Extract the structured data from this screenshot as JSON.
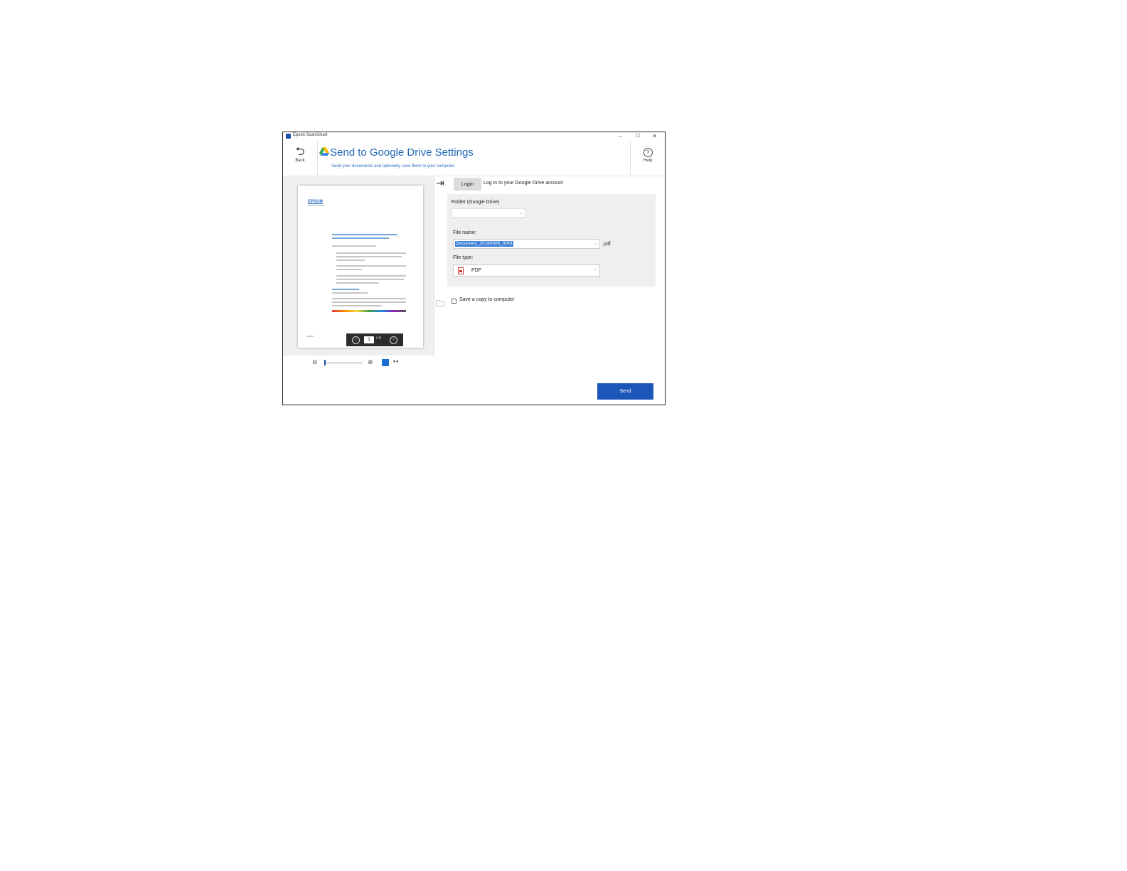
{
  "window": {
    "app_title": "Epson ScanSmart",
    "controls": {
      "minimize": "–",
      "maximize": "☐",
      "close": "✕"
    }
  },
  "header": {
    "back_label": "Back",
    "title": "Send to Google Drive Settings",
    "subtitle": "Send your documents and optionally save them to your computer.",
    "help_label": "Help"
  },
  "preview": {
    "doc_logo": "EPSON",
    "pager": {
      "current": "1",
      "of": "/ 4"
    }
  },
  "login": {
    "button_label": "Login",
    "text": "Log in to your Google Drive account"
  },
  "settings": {
    "folder_label": "Folder (Google Drive)",
    "folder_value": "",
    "file_name_label": "File name:",
    "file_name_value": "Document_20180306_0001",
    "extension": ".pdf",
    "file_type_label": "File type:",
    "file_type_value": "PDF"
  },
  "save_copy_label": "Save a copy to computer",
  "send_label": "Send",
  "colors": {
    "accent": "#1b56b8",
    "title_blue": "#1f67b8"
  }
}
